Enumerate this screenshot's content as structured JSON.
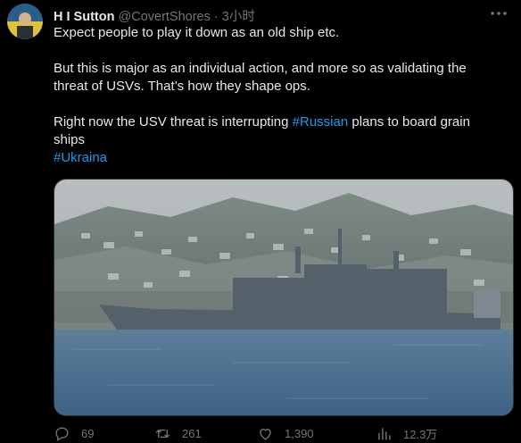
{
  "author": {
    "name": "H I Sutton",
    "handle": "@CovertShores",
    "separator": "·",
    "time": "3小时"
  },
  "tweet": {
    "line1": "Expect people to play it down as an old ship etc.",
    "line2": "But this is major as an individual action, and more so as validating the threat of USVs. That’s how they shape ops.",
    "line3_prefix": "Right now the USV threat is interrupting ",
    "line3_hashtag": "#Russian",
    "line3_suffix": " plans to board grain ships",
    "hashtag2": "#Ukraina"
  },
  "media": {
    "alt_description_icon": "photo"
  },
  "actions": {
    "replies": "69",
    "retweets": "261",
    "likes": "1,390",
    "views": "12.3万"
  },
  "colors": {
    "background": "#000000",
    "text": "#e7e9ea",
    "muted": "#71767b",
    "link": "#1d9bf0"
  }
}
